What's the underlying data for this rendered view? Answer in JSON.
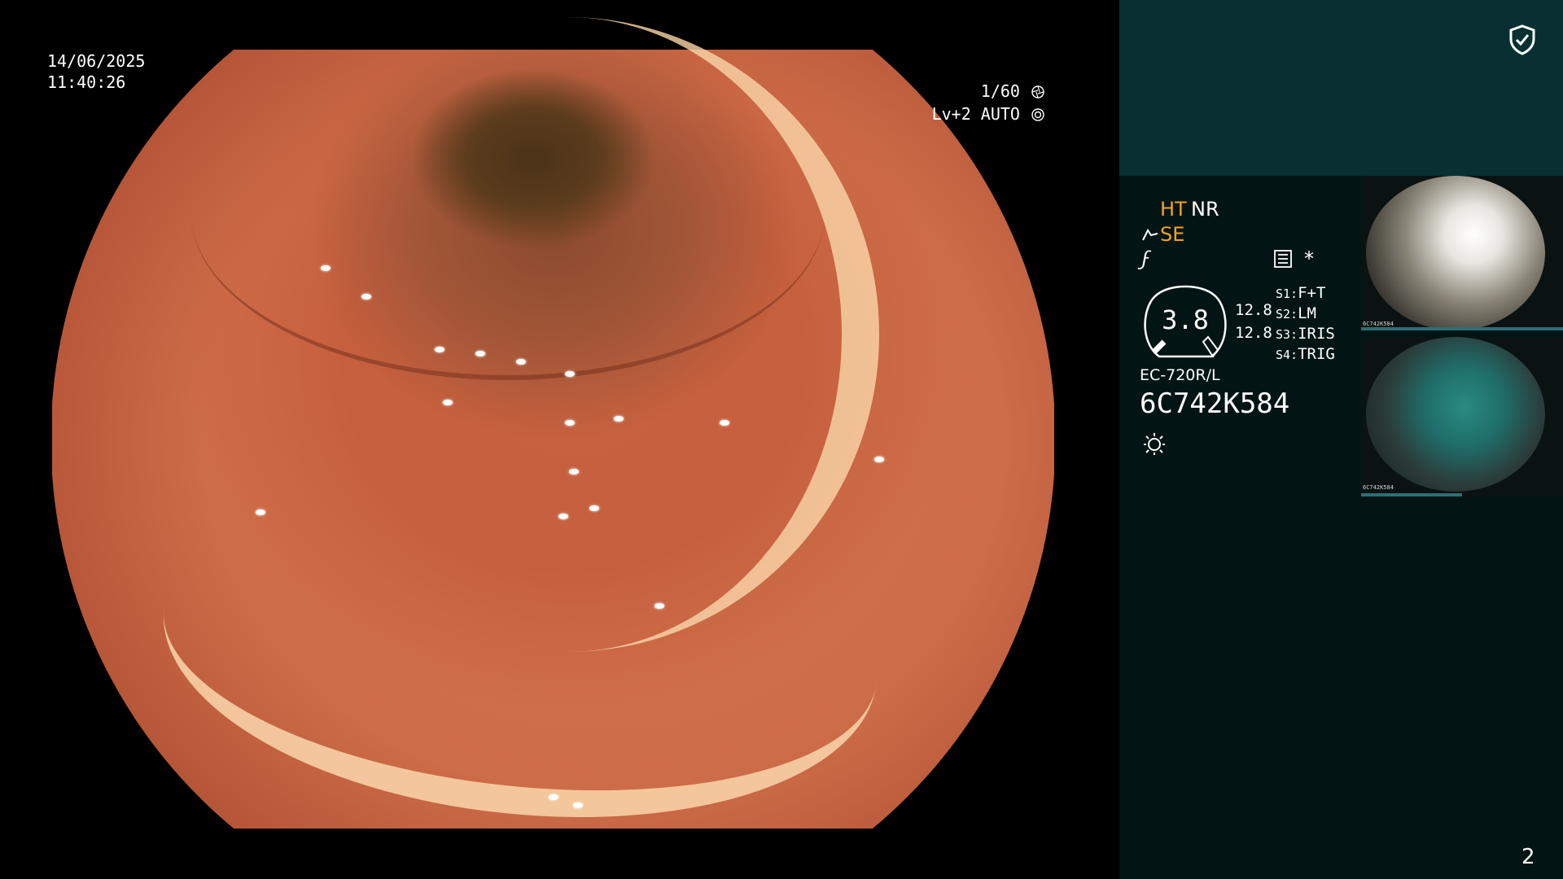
{
  "overlay": {
    "date": "14/06/2025",
    "time": "11:40:26",
    "shutter": "1/60",
    "level": "Lv+2 AUTO"
  },
  "panel": {
    "mode_ht": "HT",
    "mode_nr": "NR",
    "mode_se": "SE",
    "f_symbol": "ϝ",
    "asterisk": "*",
    "gauge_value": "3.8",
    "value_1": "12.8",
    "value_2": "12.8",
    "switches": [
      {
        "key": "S1:",
        "value": "F+T"
      },
      {
        "key": "S2:",
        "value": "LM"
      },
      {
        "key": "S3:",
        "value": "IRIS"
      },
      {
        "key": "S4:",
        "value": "TRIG"
      }
    ],
    "scope_model": "EC-720R/L",
    "serial_number": "6C742K584",
    "page_number": "2",
    "thumbnails": [
      {
        "label": "6C742K584"
      },
      {
        "label": "6C742K584"
      }
    ]
  },
  "icons": {
    "shield": "shield-check-icon",
    "shutter": "aperture-icon",
    "auto": "auto-iris-icon",
    "se": "se-probe-icon",
    "menu": "menu-list-icon",
    "light": "sun-light-icon"
  },
  "colors": {
    "panel_background": "#021514",
    "panel_top": "#083030",
    "accent_orange": "#f0a42a",
    "text_white": "#ffffff"
  }
}
